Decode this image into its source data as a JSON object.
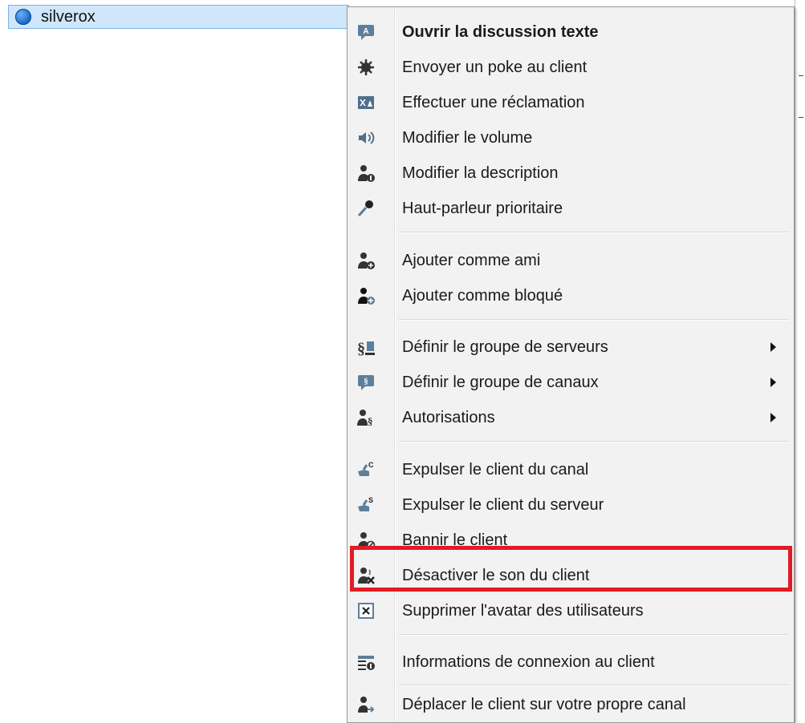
{
  "tree": {
    "client_name": "silverox"
  },
  "menu": {
    "items": [
      {
        "label": "Ouvrir la discussion texte",
        "icon": "chat-bubble-icon",
        "bold": true
      },
      {
        "label": "Envoyer un poke au client",
        "icon": "poke-icon"
      },
      {
        "label": "Effectuer une réclamation",
        "icon": "complaint-icon"
      },
      {
        "label": "Modifier le volume",
        "icon": "speaker-volume-icon"
      },
      {
        "label": "Modifier la description",
        "icon": "user-description-icon"
      },
      {
        "label": "Haut-parleur prioritaire",
        "icon": "priority-speaker-icon"
      },
      {
        "label": "Ajouter comme ami",
        "icon": "add-friend-icon"
      },
      {
        "label": "Ajouter comme bloqué",
        "icon": "add-blocked-icon"
      },
      {
        "label": "Définir le groupe de serveurs",
        "icon": "server-group-icon",
        "submenu": true
      },
      {
        "label": "Définir le groupe de canaux",
        "icon": "channel-group-icon",
        "submenu": true
      },
      {
        "label": "Autorisations",
        "icon": "permissions-icon",
        "submenu": true
      },
      {
        "label": "Expulser le client du canal",
        "icon": "kick-channel-icon"
      },
      {
        "label": "Expulser le client du serveur",
        "icon": "kick-server-icon"
      },
      {
        "label": "Bannir le client",
        "icon": "ban-client-icon"
      },
      {
        "label": "Désactiver le son du client",
        "icon": "mute-client-icon"
      },
      {
        "label": "Supprimer l'avatar des utilisateurs",
        "icon": "delete-avatar-icon"
      },
      {
        "label": "Informations de connexion au client",
        "icon": "connection-info-icon"
      },
      {
        "label": "Déplacer le client sur votre propre canal",
        "icon": "move-client-icon"
      }
    ]
  },
  "colors": {
    "highlight": "#e21b24",
    "selection_row": "#cfe6fb",
    "menu_background": "#f2f2f2"
  }
}
